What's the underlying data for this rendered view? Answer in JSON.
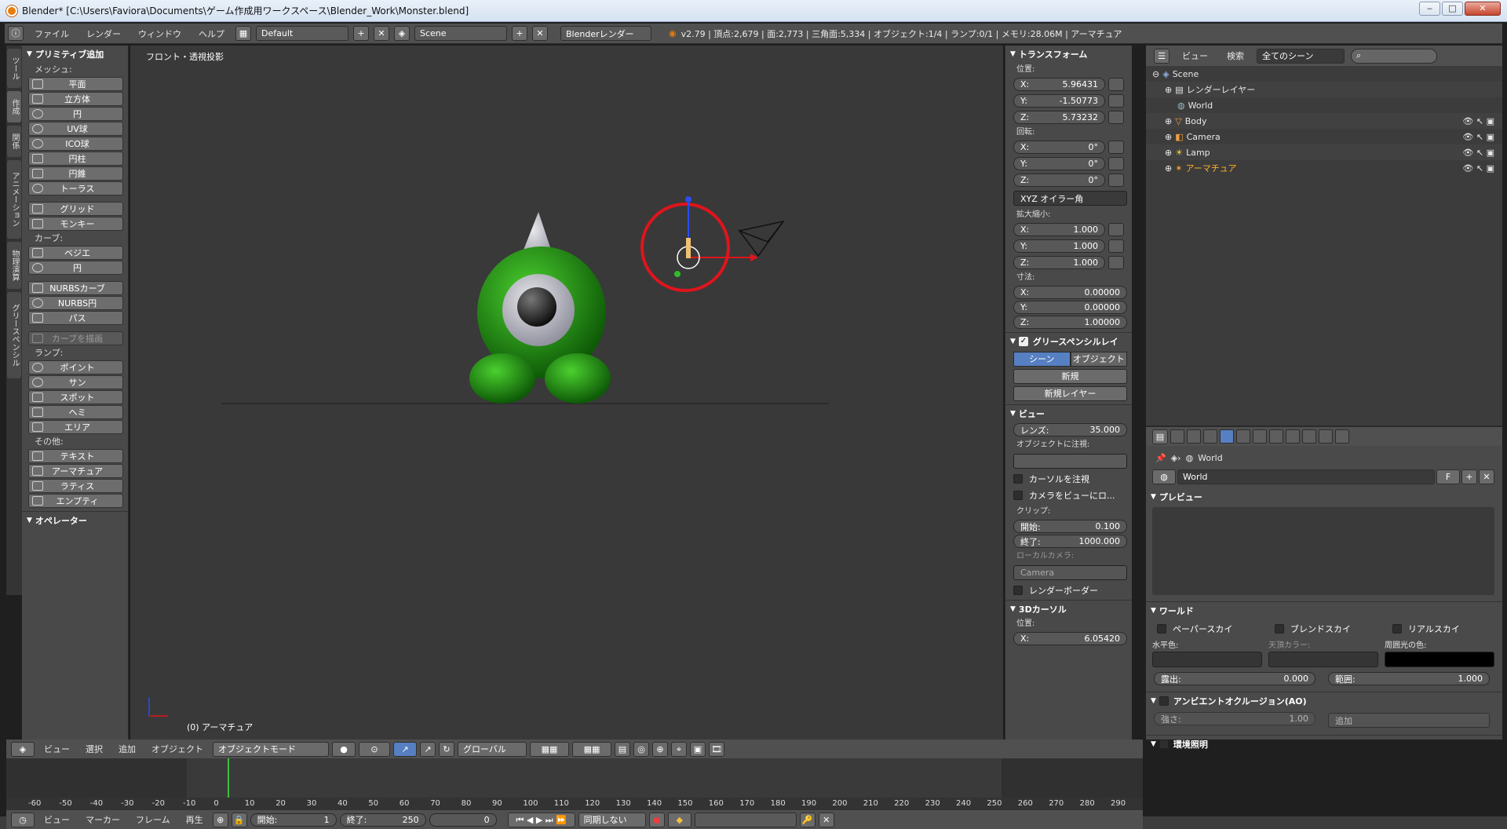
{
  "window": {
    "title": "Blender* [C:\\Users\\Faviora\\Documents\\ゲーム作成用ワークスペース\\Blender_Work\\Monster.blend]",
    "min": "‒",
    "max": "□",
    "close": "✕"
  },
  "infobar": {
    "menus": [
      "ファイル",
      "レンダー",
      "ウィンドウ",
      "ヘルプ"
    ],
    "layout": "Default",
    "scene": "Scene",
    "engine": "Blenderレンダー",
    "stats": "v2.79 | 頂点:2,679 | 面:2,773 | 三角面:5,334 | オブジェクト:1/4 | ランプ:0/1 | メモリ:28.06M | アーマチュア"
  },
  "lefttabs": [
    "ツール",
    "作成",
    "関係",
    "アニメーション",
    "物理演算",
    "グリースペンシル"
  ],
  "toolshelf": {
    "panel_title": "プリミティブ追加",
    "mesh_label": "メッシュ:",
    "mesh": [
      "平面",
      "立方体",
      "円",
      "UV球",
      "ICO球",
      "円柱",
      "円錐",
      "トーラス"
    ],
    "mesh2": [
      "グリッド",
      "モンキー"
    ],
    "curve_label": "カーブ:",
    "curve": [
      "ベジエ",
      "円"
    ],
    "curve2": [
      "NURBSカーブ",
      "NURBS円",
      "パス"
    ],
    "draw_curve": "カーブを描画",
    "lamp_label": "ランプ:",
    "lamp": [
      "ポイント",
      "サン",
      "スポット",
      "ヘミ",
      "エリア"
    ],
    "other_label": "その他:",
    "other": [
      "テキスト",
      "アーマチュア",
      "ラティス",
      "エンプティ"
    ],
    "operator": "オペレーター"
  },
  "viewport": {
    "title": "フロント・透視投影",
    "object": "(0) アーマチュア"
  },
  "npanel": {
    "transform": "トランスフォーム",
    "location_label": "位置:",
    "location": [
      {
        "l": "X:",
        "v": "5.96431"
      },
      {
        "l": "Y:",
        "v": "-1.50773"
      },
      {
        "l": "Z:",
        "v": "5.73232"
      }
    ],
    "rotation_label": "回転:",
    "rotation": [
      {
        "l": "X:",
        "v": "0°"
      },
      {
        "l": "Y:",
        "v": "0°"
      },
      {
        "l": "Z:",
        "v": "0°"
      }
    ],
    "rotation_mode": "XYZ オイラー角",
    "scale_label": "拡大縮小:",
    "scale": [
      {
        "l": "X:",
        "v": "1.000"
      },
      {
        "l": "Y:",
        "v": "1.000"
      },
      {
        "l": "Z:",
        "v": "1.000"
      }
    ],
    "dims_label": "寸法:",
    "dims": [
      {
        "l": "X:",
        "v": "0.00000"
      },
      {
        "l": "Y:",
        "v": "0.00000"
      },
      {
        "l": "Z:",
        "v": "1.00000"
      }
    ],
    "grease": "グリースペンシルレイ",
    "grease_scene": "シーン",
    "grease_object": "オブジェクト",
    "grease_new": "新規",
    "grease_new_layer": "新規レイヤー",
    "view": "ビュー",
    "lens_label": "レンズ:",
    "lens": "35.000",
    "lock_label": "オブジェクトに注視:",
    "lock_cursor": "カーソルを注視",
    "lock_camera": "カメラをビューにロ...",
    "clip_label": "クリップ:",
    "clip_start_l": "開始:",
    "clip_start": "0.100",
    "clip_end_l": "終了:",
    "clip_end": "1000.000",
    "local_camera_label": "ローカルカメラ:",
    "local_camera": "Camera",
    "render_border": "レンダーボーダー",
    "cursor": "3Dカーソル",
    "cursor_pos_label": "位置:",
    "cursor_x_l": "X:",
    "cursor_x": "6.05420"
  },
  "outliner": {
    "view": "ビュー",
    "search": "検索",
    "filter": "全てのシーン",
    "items": [
      "Scene",
      "レンダーレイヤー",
      "World",
      "Body",
      "Camera",
      "Lamp",
      "アーマチュア"
    ]
  },
  "props": {
    "breadcrumb": "World",
    "datablock": "World",
    "fake": "F",
    "preview": "プレビュー",
    "world": "ワールド",
    "paper_sky": "ペーパースカイ",
    "blend_sky": "ブレンドスカイ",
    "real_sky": "リアルスカイ",
    "horizon": "水平色:",
    "zenith": "天頂カラー:",
    "ambient": "周囲光の色:",
    "exposure_l": "露出:",
    "exposure": "0.000",
    "range_l": "範囲:",
    "range": "1.000",
    "ao": "アンビエントオクルージョン(AO)",
    "strength_l": "強さ:",
    "strength": "1.00",
    "blend_mode": "追加",
    "env": "環境照明"
  },
  "view3d_header": {
    "menus": [
      "ビュー",
      "選択",
      "追加",
      "オブジェクト"
    ],
    "mode": "オブジェクトモード",
    "orientation": "グローバル"
  },
  "timeline": {
    "ticks": [
      "-60",
      "-50",
      "-40",
      "-30",
      "-20",
      "-10",
      "0",
      "10",
      "20",
      "30",
      "40",
      "50",
      "60",
      "70",
      "80",
      "90",
      "100",
      "110",
      "120",
      "130",
      "140",
      "150",
      "160",
      "170",
      "180",
      "190",
      "200",
      "210",
      "220",
      "230",
      "240",
      "250",
      "260",
      "270",
      "280",
      "290"
    ],
    "menus": [
      "ビュー",
      "マーカー",
      "フレーム",
      "再生"
    ],
    "start_l": "開始:",
    "start": "1",
    "end_l": "終了:",
    "end": "250",
    "current": "0",
    "sync": "同期しない"
  },
  "colors": {
    "accent": "#5680c2",
    "monster": "#1f8a12",
    "ring": "#e0141c"
  }
}
